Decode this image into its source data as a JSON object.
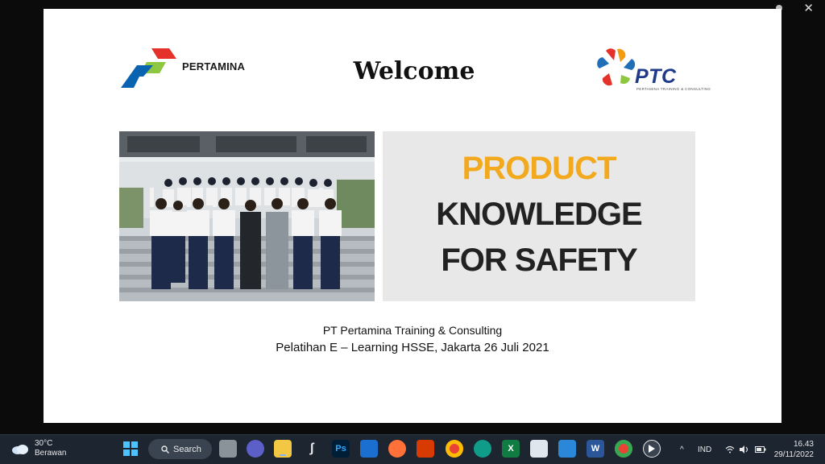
{
  "window": {
    "close_glyph": "✕"
  },
  "slide": {
    "pertamina_logo_text": "PERTAMINA",
    "welcome": "Welcome",
    "ptc_logo_text": "PTC",
    "ptc_logo_subtext": "PERTAMINA TRAINING & CONSULTING",
    "title_line1": "PRODUCT",
    "title_line2": "KNOWLEDGE",
    "title_line3": "FOR SAFETY",
    "subtitle_company": "PT Pertamina Training & Consulting",
    "subtitle_event": "Pelatihan E – Learning HSSE, Jakarta 26 Juli 2021",
    "colors": {
      "title_accent": "#f2a91d",
      "pertamina_red": "#e4322b",
      "pertamina_green": "#8dc63f",
      "pertamina_blue": "#0a63b0"
    }
  },
  "taskbar": {
    "weather_temp": "30°C",
    "weather_desc": "Berawan",
    "search_label": "Search",
    "apps": [
      {
        "name": "windows-start-icon"
      },
      {
        "name": "file-explorer-icon"
      },
      {
        "name": "teams-chat-icon"
      },
      {
        "name": "folder-icon"
      },
      {
        "name": "sketch-app-icon"
      },
      {
        "name": "photoshop-icon",
        "label": "Ps"
      },
      {
        "name": "mail-icon"
      },
      {
        "name": "firefox-icon"
      },
      {
        "name": "office-icon"
      },
      {
        "name": "chrome-icon"
      },
      {
        "name": "edge-icon"
      },
      {
        "name": "excel-icon",
        "label": "X"
      },
      {
        "name": "whiteboard-icon"
      },
      {
        "name": "media-player-icon"
      },
      {
        "name": "word-icon",
        "label": "W"
      },
      {
        "name": "chrome-icon-2"
      },
      {
        "name": "video-player-icon"
      }
    ],
    "tray": {
      "chevron": "^",
      "language": "IND"
    },
    "clock_time": "16.43",
    "clock_date": "29/11/2022"
  }
}
